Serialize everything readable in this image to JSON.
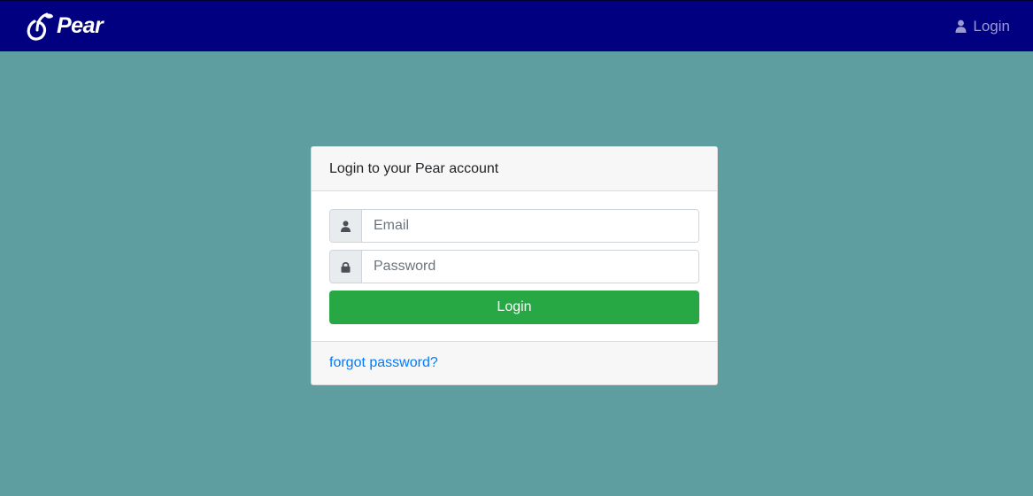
{
  "navbar": {
    "brand": {
      "logo_icon": "pear-logo-icon",
      "name": "Pear"
    },
    "login": {
      "icon": "user-icon",
      "label": "Login"
    }
  },
  "login_card": {
    "title": "Login to your Pear account",
    "email": {
      "icon": "user-icon",
      "placeholder": "Email",
      "value": ""
    },
    "password": {
      "icon": "lock-icon",
      "placeholder": "Password",
      "value": ""
    },
    "submit_label": "Login",
    "forgot_link": "forgot password?"
  },
  "colors": {
    "page_background": "#5f9ea0",
    "navbar_background": "#000080",
    "login_button": "#28a745",
    "link": "#007bff"
  }
}
